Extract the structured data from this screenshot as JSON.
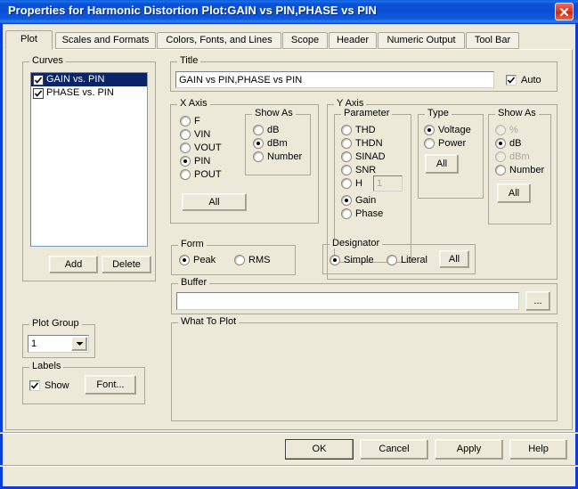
{
  "window": {
    "title": "Properties for Harmonic Distortion Plot:GAIN vs PIN,PHASE vs PIN",
    "close_label": "×",
    "titlebar_color": "#0A4ED4",
    "face_color": "#ECE9D8",
    "border_color": "#0A3ED8"
  },
  "tabs": [
    {
      "label": "Plot",
      "active": true
    },
    {
      "label": "Scales and Formats",
      "active": false
    },
    {
      "label": "Colors, Fonts, and Lines",
      "active": false
    },
    {
      "label": "Scope",
      "active": false
    },
    {
      "label": "Header",
      "active": false
    },
    {
      "label": "Numeric Output",
      "active": false
    },
    {
      "label": "Tool Bar",
      "active": false
    }
  ],
  "curves": {
    "group_label": "Curves",
    "items": [
      {
        "label": "GAIN vs. PIN",
        "checked": true,
        "selected": true
      },
      {
        "label": "PHASE vs. PIN",
        "checked": true,
        "selected": false
      }
    ],
    "add_label": "Add",
    "delete_label": "Delete"
  },
  "plot_group": {
    "group_label": "Plot Group",
    "value": "1"
  },
  "labels": {
    "group_label": "Labels",
    "show_label": "Show",
    "show_checked": true,
    "font_label": "Font..."
  },
  "title": {
    "group_label": "Title",
    "value": "GAIN vs PIN,PHASE vs PIN",
    "auto_label": "Auto",
    "auto_checked": true
  },
  "x_axis": {
    "group_label": "X Axis",
    "options": [
      {
        "label": "F",
        "checked": false
      },
      {
        "label": "VIN",
        "checked": false
      },
      {
        "label": "VOUT",
        "checked": false
      },
      {
        "label": "PIN",
        "checked": true
      },
      {
        "label": "POUT",
        "checked": false
      }
    ],
    "all_label": "All",
    "show_as": {
      "group_label": "Show As",
      "options": [
        {
          "label": "dB",
          "checked": false,
          "disabled": false
        },
        {
          "label": "dBm",
          "checked": true,
          "disabled": false
        },
        {
          "label": "Number",
          "checked": false,
          "disabled": false
        }
      ]
    }
  },
  "y_axis": {
    "group_label": "Y Axis",
    "parameter": {
      "group_label": "Parameter",
      "options": [
        {
          "label": "THD",
          "checked": false
        },
        {
          "label": "THDN",
          "checked": false
        },
        {
          "label": "SINAD",
          "checked": false
        },
        {
          "label": "SNR",
          "checked": false
        },
        {
          "label": "H",
          "checked": false
        },
        {
          "label": "Gain",
          "checked": true
        },
        {
          "label": "Phase",
          "checked": false
        }
      ],
      "harmonic_value": "1",
      "harmonic_disabled": true
    },
    "type": {
      "group_label": "Type",
      "options": [
        {
          "label": "Voltage",
          "checked": true,
          "disabled": false
        },
        {
          "label": "Power",
          "checked": false,
          "disabled": false
        }
      ],
      "all_label": "All"
    },
    "show_as": {
      "group_label": "Show As",
      "options": [
        {
          "label": "%",
          "checked": false,
          "disabled": true
        },
        {
          "label": "dB",
          "checked": true,
          "disabled": false
        },
        {
          "label": "dBm",
          "checked": false,
          "disabled": true
        },
        {
          "label": "Number",
          "checked": false,
          "disabled": false
        }
      ],
      "all_label": "All"
    }
  },
  "form": {
    "group_label": "Form",
    "options": [
      {
        "label": "Peak",
        "checked": true
      },
      {
        "label": "RMS",
        "checked": false
      }
    ]
  },
  "designator": {
    "group_label": "Designator",
    "options": [
      {
        "label": "Simple",
        "checked": true
      },
      {
        "label": "Literal",
        "checked": false
      }
    ],
    "all_label": "All"
  },
  "buffer": {
    "group_label": "Buffer",
    "value": "",
    "browse_label": "..."
  },
  "what_to_plot": {
    "group_label": "What To Plot"
  },
  "buttons": {
    "ok": "OK",
    "cancel": "Cancel",
    "apply": "Apply",
    "help": "Help"
  }
}
